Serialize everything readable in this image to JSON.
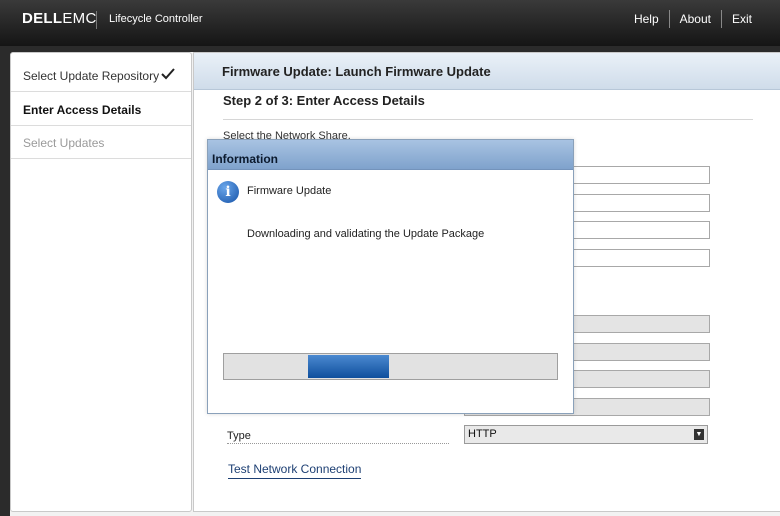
{
  "header": {
    "logo_dell": "DELL",
    "logo_emc": "EMC",
    "app_name": "Lifecycle Controller",
    "nav": [
      "Help",
      "About",
      "Exit"
    ]
  },
  "sidebar": {
    "items": [
      {
        "label": "Select Update Repository",
        "state": "completed"
      },
      {
        "label": "Enter Access Details",
        "state": "active"
      },
      {
        "label": "Select Updates",
        "state": "disabled"
      }
    ]
  },
  "main": {
    "header_title": "Firmware Update: Launch Firmware Update",
    "step_title": "Step 2 of 3: Enter Access Details",
    "select_share_label": "Select the Network Share.",
    "type_label": "Type",
    "type_value": "HTTP",
    "test_link": "Test Network Connection"
  },
  "dialog": {
    "title": "Information",
    "heading": "Firmware Update",
    "message": "Downloading and validating the Update Package",
    "icon": "info-icon"
  },
  "colors": {
    "dialog_title": "#8fb0d6",
    "progress_fill": "#1a5aa8",
    "link": "#1d3f73"
  }
}
